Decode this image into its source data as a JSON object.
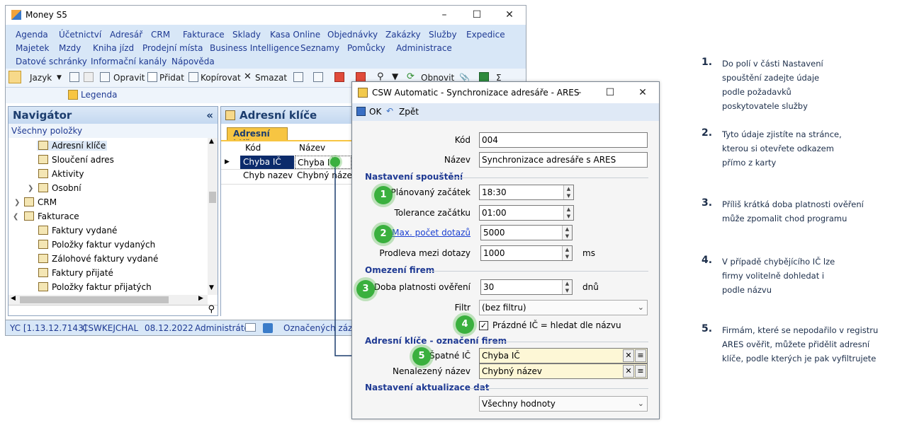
{
  "main_window": {
    "title": "Money S5",
    "menu_row1": [
      "Agenda",
      "Účetnictví",
      "Adresář",
      "CRM",
      "Fakturace",
      "Sklady",
      "Kasa Online",
      "Objednávky",
      "Zakázky",
      "Služby",
      "Expedice"
    ],
    "menu_row2": [
      "Majetek",
      "Mzdy",
      "Kniha jízd",
      "Prodejní místa",
      "Business Intelligence",
      "Seznamy",
      "Pomůcky",
      "Administrace"
    ],
    "menu_row3": [
      "Datové schránky",
      "Informační kanály",
      "Nápověda"
    ],
    "toolbar": {
      "jazyk": "Jazyk",
      "opravit": "Opravit",
      "pridat": "Přidat",
      "kopirovat": "Kopírovat",
      "smazat": "Smazat",
      "obnovit": "Obnovit",
      "legenda": "Legenda"
    },
    "navigator": {
      "title": "Navigátor",
      "collapse": "«",
      "subtitle": "Všechny položky",
      "items": [
        "Adresní klíče",
        "Sloučení adres",
        "Aktivity",
        "Osobní",
        "CRM",
        "Fakturace",
        "Faktury vydané",
        "Položky faktur vydaných",
        "Zálohové faktury vydané",
        "Faktury přijaté",
        "Položky faktur přijatých"
      ]
    },
    "ak_panel": {
      "title": "Adresní klíče",
      "tab": "Adresní klíče",
      "columns": [
        "Kód",
        "Název"
      ],
      "rows": [
        [
          "Chyba IČ",
          "Chyba IČ"
        ],
        [
          "Chyb nazev",
          "Chybný název"
        ]
      ]
    },
    "statusbar": [
      "YC [1.13.12.7143]",
      "CSWKEJCHAL",
      "08.12.2022",
      "Administráto",
      "Označených zázna"
    ]
  },
  "dialog": {
    "title": "CSW Automatic - Synchronizace adresáře - ARES",
    "ok": "OK",
    "zpet": "Zpět",
    "kod_label": "Kód",
    "kod_value": "004",
    "nazev_label": "Název",
    "nazev_value": "Synchronizace adresáře s ARES",
    "sect1": "Nastavení spouštění",
    "planovany_label": "Plánovaný začátek",
    "planovany_value": "18:30",
    "tolerance_label": "Tolerance začátku",
    "tolerance_value": "01:00",
    "maxpocet_label": "Max. počet dotazů",
    "maxpocet_value": "5000",
    "prodleva_label": "Prodleva mezi dotazy",
    "prodleva_value": "1000",
    "prodleva_unit": "ms",
    "sect2": "Omezení firem",
    "doba_label": "Doba platnosti ověření",
    "doba_value": "30",
    "doba_unit": "dnů",
    "filtr_label": "Filtr",
    "filtr_value": "(bez filtru)",
    "prazdne_label": "Prázdné IČ = hledat dle názvu",
    "sect3": "Adresní klíče - označení firem",
    "spatne_label": "Špatné IČ",
    "spatne_value": "Chyba IČ",
    "nenalez_label": "Nenalezený název",
    "nenalez_value": "Chybný název",
    "sect4": "Nastavení aktualizace dat",
    "aktual_value": "Všechny hodnoty"
  },
  "badges": [
    "1",
    "2",
    "3",
    "4",
    "5"
  ],
  "notes": [
    {
      "num": "1.",
      "text": "Do polí v části Nastavení spouštění zadejte údaje podle požadavků poskytovatele služby"
    },
    {
      "num": "2.",
      "text": "Tyto údaje zjistíte na stránce, kterou si otevřete odkazem přímo z karty"
    },
    {
      "num": "3.",
      "text": "Příliš krátká doba platnosti ověření může zpomalit chod programu"
    },
    {
      "num": "4.",
      "text": "V případě chybějícího IČ lze firmy volitelně dohledat i podle názvu"
    },
    {
      "num": "5.",
      "text": "Firmám, které se nepodařilo v registru ARES ověřit, můžete přidělit adresní klíče, podle kterých je pak vyfiltrujete"
    }
  ],
  "colors": {
    "badge": "#3ab03e",
    "link": "#1a3fd1",
    "menu": "#1f3a93",
    "tab": "#f7c542"
  }
}
